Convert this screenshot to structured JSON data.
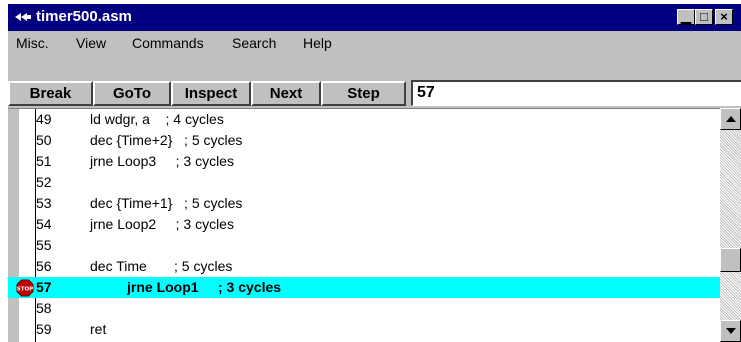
{
  "window": {
    "title": "timer500.asm",
    "icon": "app-icon",
    "controls": {
      "minimize": "▁",
      "maximize": "□",
      "close": "×"
    }
  },
  "menu": [
    "Misc.",
    "View",
    "Commands",
    "Search",
    "Help"
  ],
  "toolbar": {
    "buttons": [
      "Break",
      "GoTo",
      "Inspect",
      "Next",
      "Step"
    ],
    "goto_value": "57"
  },
  "code": {
    "lines": [
      {
        "num": "49",
        "text": "ld wdgr, a    ; 4 cycles"
      },
      {
        "num": "50",
        "text": "dec {Time+2}   ; 5 cycles"
      },
      {
        "num": "51",
        "text": "jrne Loop3     ; 3 cycles"
      },
      {
        "num": "52",
        "text": ""
      },
      {
        "num": "53",
        "text": "dec {Time+1}   ; 5 cycles"
      },
      {
        "num": "54",
        "text": "jrne Loop2     ; 3 cycles"
      },
      {
        "num": "55",
        "text": ""
      },
      {
        "num": "56",
        "text": "dec Time       ; 5 cycles"
      },
      {
        "num": "57",
        "text": "jrne Loop1     ; 3 cycles",
        "current": true,
        "breakpoint": "STOP"
      },
      {
        "num": "58",
        "text": ""
      },
      {
        "num": "59",
        "text": "ret"
      }
    ]
  },
  "colors": {
    "title_bar": "#000080",
    "current_line": "#00ffff",
    "breakpoint": "#c00000",
    "face": "#c0c0c0"
  }
}
